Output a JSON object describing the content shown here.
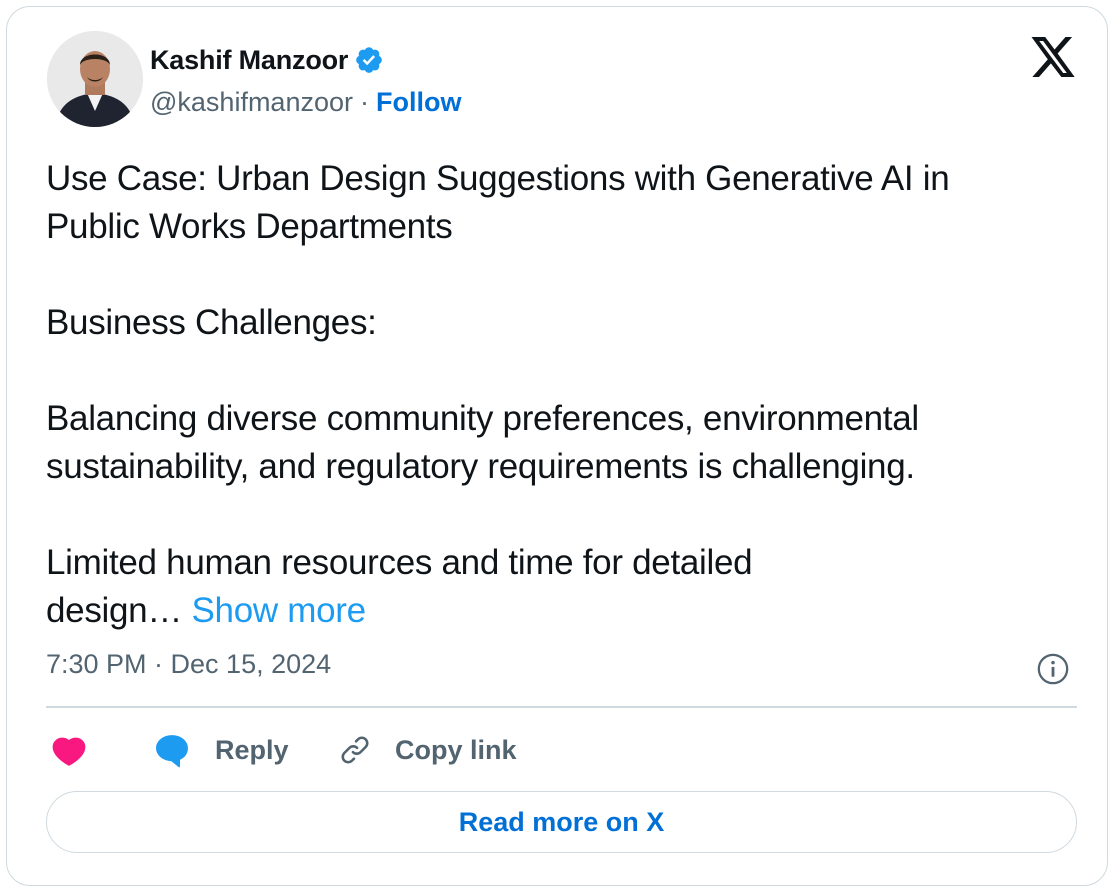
{
  "author": {
    "display_name": "Kashif Manzoor",
    "handle": "@kashifmanzoor",
    "separator": "·",
    "follow_label": "Follow",
    "verified": true
  },
  "tweet": {
    "lines_block1": [
      "Use Case: Urban Design Suggestions with Generative AI in",
      "Public Works Departments"
    ],
    "line_block2": "Business Challenges:",
    "lines_block3": [
      "Balancing diverse community preferences, environmental",
      "sustainability, and regulatory requirements is challenging."
    ],
    "lines_block4": [
      "Limited human resources and time for detailed",
      "design…"
    ],
    "show_more_label": "Show more",
    "timestamp": "7:30 PM · Dec 15, 2024"
  },
  "actions": {
    "reply_label": "Reply",
    "copy_link_label": "Copy link",
    "read_more_label": "Read more on X"
  },
  "icons": {
    "verified": "verified-badge-icon",
    "brand": "x-logo-icon",
    "info": "info-icon",
    "like": "heart-icon",
    "reply": "reply-bubble-icon",
    "copy": "link-icon"
  },
  "colors": {
    "accent": "#1d9bf0",
    "link_dark": "#006fd6",
    "heart": "#f91880",
    "text": "#0f1419",
    "secondary_text": "#536471",
    "border": "#cfd9de"
  }
}
